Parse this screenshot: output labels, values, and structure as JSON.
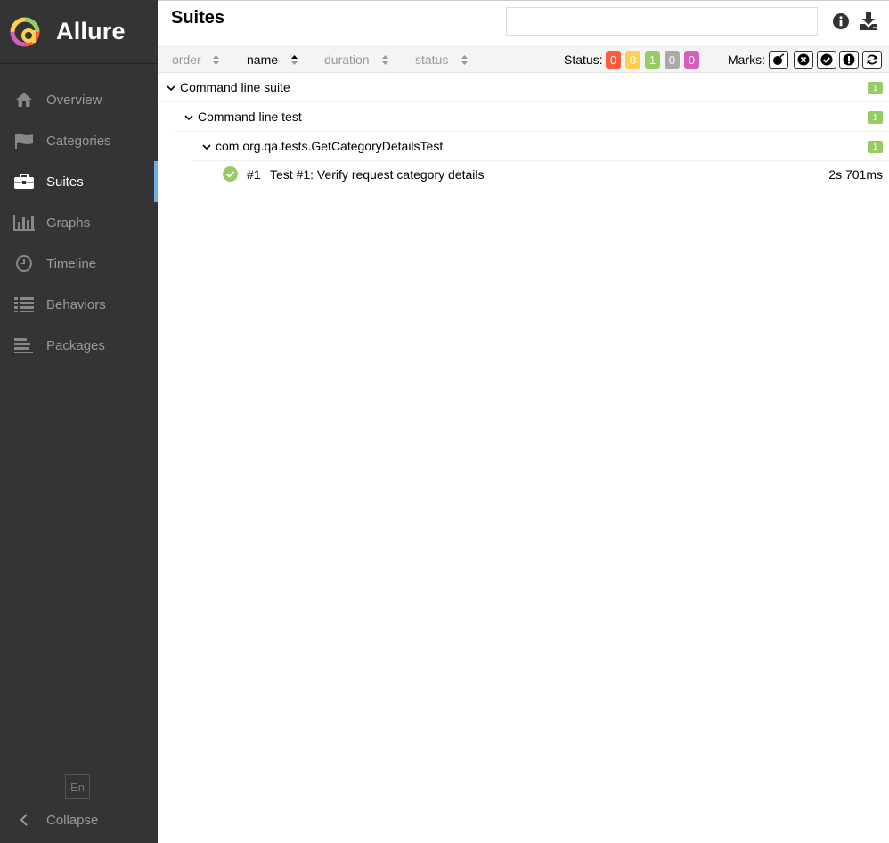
{
  "brand": {
    "name": "Allure"
  },
  "sidebar": {
    "items": [
      {
        "label": "Overview",
        "icon": "home-icon"
      },
      {
        "label": "Categories",
        "icon": "flag-icon"
      },
      {
        "label": "Suites",
        "icon": "briefcase-icon",
        "active": true
      },
      {
        "label": "Graphs",
        "icon": "bar-chart-icon"
      },
      {
        "label": "Timeline",
        "icon": "clock-icon"
      },
      {
        "label": "Behaviors",
        "icon": "list-icon"
      },
      {
        "label": "Packages",
        "icon": "align-left-icon"
      }
    ],
    "language": "En",
    "collapse_label": "Collapse"
  },
  "header": {
    "title": "Suites",
    "search": {
      "value": "",
      "placeholder": ""
    },
    "icons": [
      "info-icon",
      "download-icon"
    ]
  },
  "toolbar": {
    "sorters": [
      "order",
      "name",
      "duration",
      "status"
    ],
    "active_sorter": "name",
    "status_label": "Status:",
    "status_counts": [
      {
        "status": "failed",
        "count": "0",
        "color": "#fd5a3e"
      },
      {
        "status": "broken",
        "count": "0",
        "color": "#ffd050"
      },
      {
        "status": "passed",
        "count": "1",
        "color": "#97cc64"
      },
      {
        "status": "skipped",
        "count": "0",
        "color": "#aaaaaa"
      },
      {
        "status": "unknown",
        "count": "0",
        "color": "#d35ebe"
      }
    ],
    "marks_label": "Marks:",
    "marks": [
      "bomb-icon",
      "times-circle-icon",
      "check-circle-icon",
      "exclamation-circle-icon",
      "refresh-icon"
    ]
  },
  "tree": {
    "suite": {
      "label": "Command line suite",
      "count": "1"
    },
    "test": {
      "label": "Command line test",
      "count": "1"
    },
    "class": {
      "label": "com.org.qa.tests.GetCategoryDetailsTest",
      "count": "1"
    },
    "case": {
      "number": "#1",
      "name": "Test #1: Verify request category details",
      "duration": "2s 701ms",
      "status": "passed"
    }
  }
}
